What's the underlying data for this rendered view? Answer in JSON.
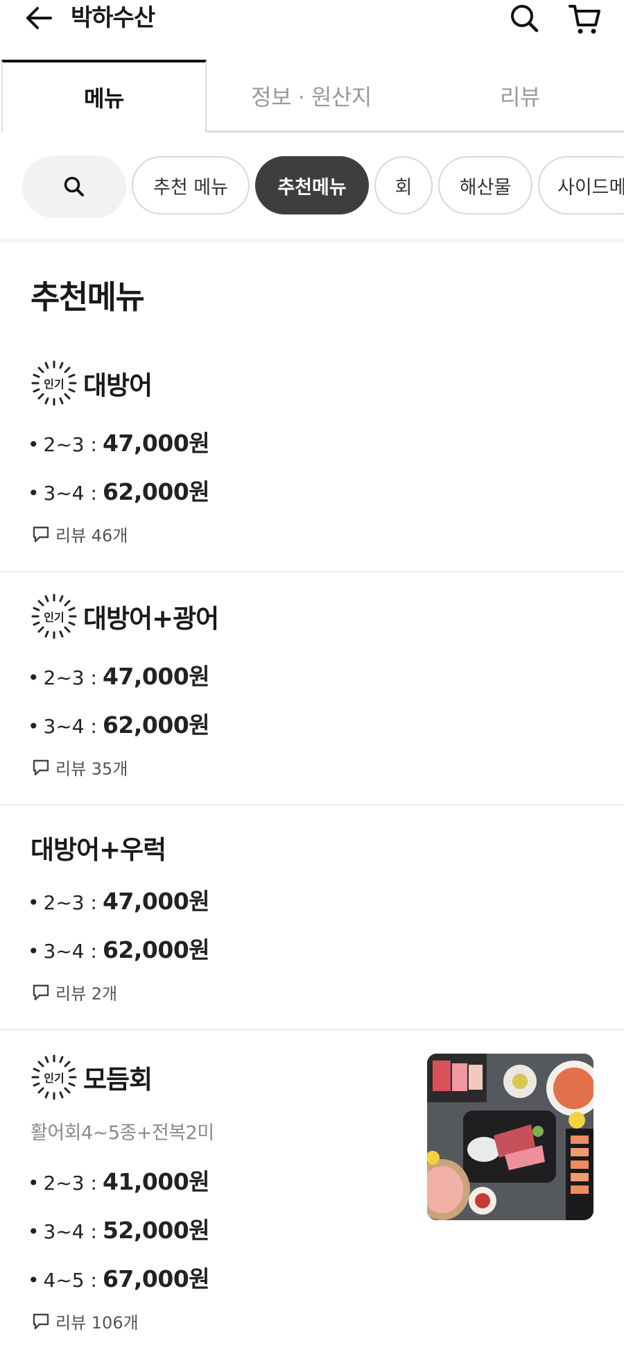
{
  "header": {
    "store_name": "박하수산",
    "icons": [
      "back-arrow-icon",
      "search-icon",
      "cart-icon"
    ]
  },
  "tabs": [
    {
      "label": "메뉴",
      "active": true
    },
    {
      "label": "정보 · 원산지",
      "active": false
    },
    {
      "label": "리뷰",
      "active": false
    }
  ],
  "chips": [
    {
      "label": "추천 메뉴",
      "selected": false
    },
    {
      "label": "추천메뉴",
      "selected": true
    },
    {
      "label": "회",
      "selected": false
    },
    {
      "label": "해산물",
      "selected": false
    },
    {
      "label": "사이드메",
      "selected": false
    }
  ],
  "section": {
    "title": "추천메뉴"
  },
  "badge_label": "인기",
  "menu_items": [
    {
      "name": "대방어",
      "popular": true,
      "prices": [
        {
          "size": "2~3 :",
          "price": "47,000원"
        },
        {
          "size": "3~4 :",
          "price": "62,000원"
        }
      ],
      "reviews": "리뷰 46개"
    },
    {
      "name": "대방어+광어",
      "popular": true,
      "prices": [
        {
          "size": "2~3 :",
          "price": "47,000원"
        },
        {
          "size": "3~4 :",
          "price": "62,000원"
        }
      ],
      "reviews": "리뷰 35개"
    },
    {
      "name": "대방어+우럭",
      "popular": false,
      "prices": [
        {
          "size": "2~3 :",
          "price": "47,000원"
        },
        {
          "size": "3~4 :",
          "price": "62,000원"
        }
      ],
      "reviews": "리뷰 2개"
    },
    {
      "name": "모듬회",
      "popular": true,
      "description": "활어회4~5종+전복2미",
      "prices": [
        {
          "size": "2~3 :",
          "price": "41,000원"
        },
        {
          "size": "3~4 :",
          "price": "52,000원"
        },
        {
          "size": "4~5 :",
          "price": "67,000원"
        }
      ],
      "reviews": "리뷰 106개",
      "has_photo": true
    }
  ],
  "colors": {
    "selected_chip": "#3e3e3e",
    "chip_border": "#d8d8d8",
    "muted_text": "#8a8a8a",
    "divider": "#f0f0f0"
  }
}
